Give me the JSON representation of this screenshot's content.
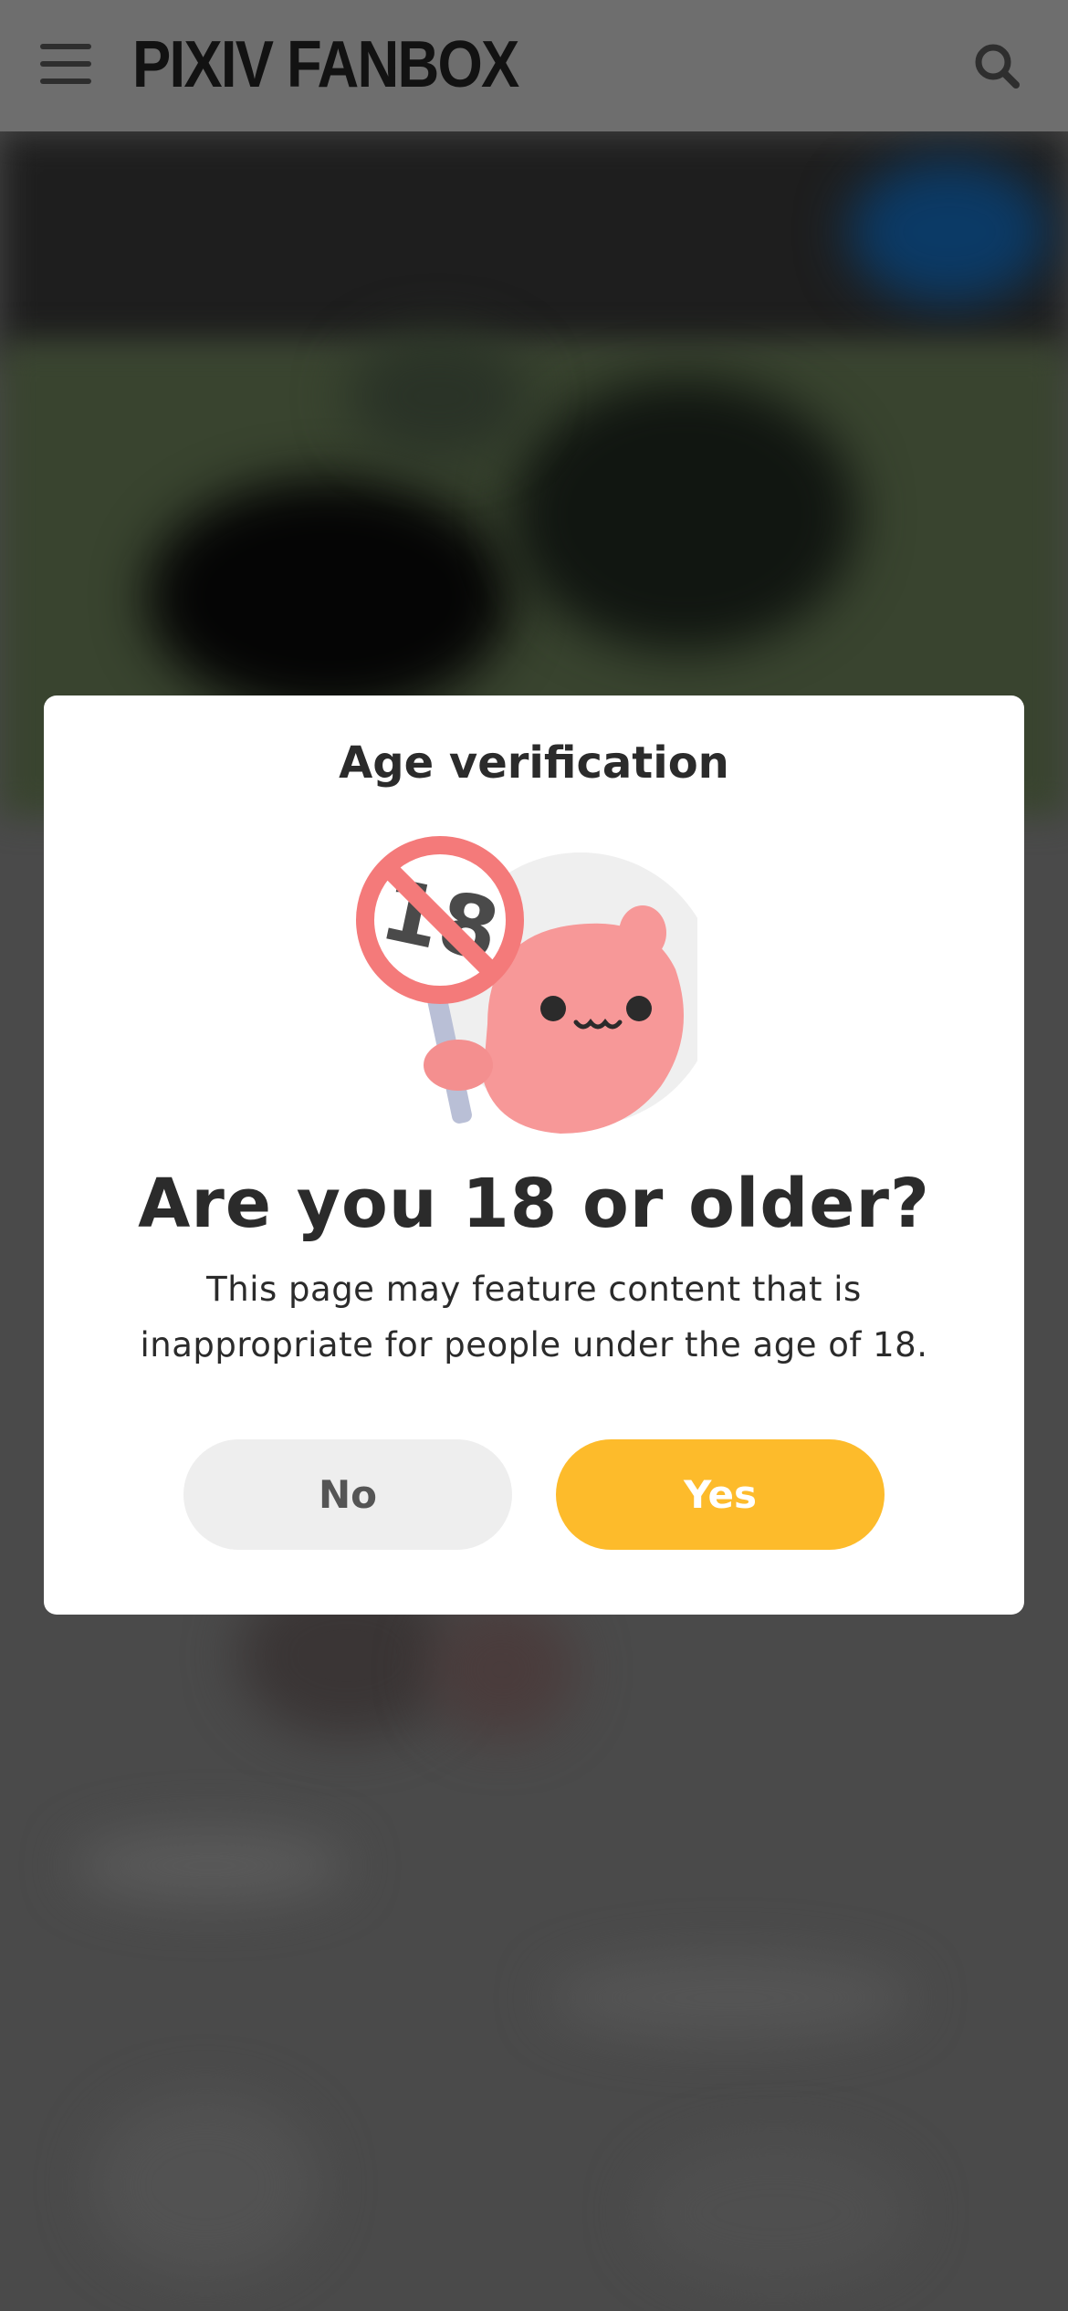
{
  "header": {
    "logo_text": "PIXIV FANBOX",
    "menu_icon": "hamburger-menu-icon",
    "search_icon": "search-icon"
  },
  "modal": {
    "title": "Age verification",
    "illustration": "age-18-restricted-mascot-icon",
    "question": "Are you 18 or older?",
    "description": "This page may feature content that is inappropriate for people under the age of 18.",
    "no_label": "No",
    "yes_label": "Yes"
  },
  "colors": {
    "yes_button": "#fdbb2b",
    "no_button": "#eeeeee",
    "header_bg": "#6e6e6e",
    "text": "#2b2b2b"
  }
}
